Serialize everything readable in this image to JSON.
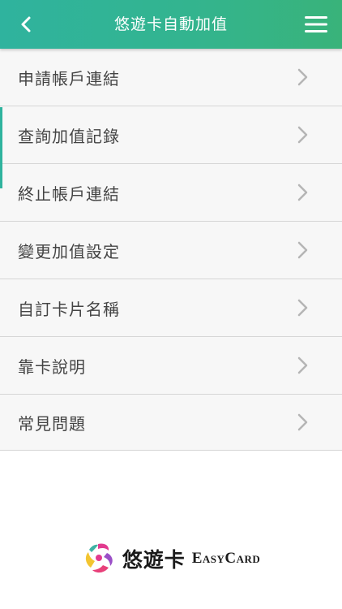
{
  "header": {
    "title": "悠遊卡自動加值",
    "back_icon": "chevron-left-icon",
    "menu_icon": "hamburger-menu-icon",
    "background_colors": [
      "#2fb39e",
      "#39b37a"
    ]
  },
  "menu": {
    "items": [
      {
        "label": "申請帳戶連結"
      },
      {
        "label": "查詢加值記錄"
      },
      {
        "label": "終止帳戶連結"
      },
      {
        "label": "變更加值設定"
      },
      {
        "label": "自訂卡片名稱"
      },
      {
        "label": "靠卡說明"
      },
      {
        "label": "常見問題"
      }
    ],
    "chevron_icon": "chevron-right-icon"
  },
  "footer": {
    "logo_chinese": "悠遊卡",
    "logo_english": "EasyCard"
  }
}
